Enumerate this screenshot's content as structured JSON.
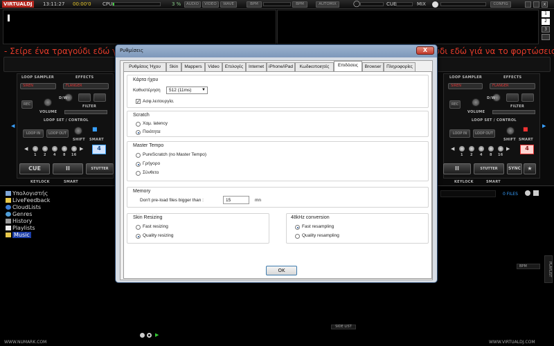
{
  "topbar": {
    "logo": "VIRTUALDJ",
    "clock": "13:11:27",
    "timer": "00:00'0",
    "cpu_label": "CPU",
    "cpu_value": "3 %",
    "buttons": [
      "AUDIO",
      "VIDEO",
      "WAVE",
      "BPM",
      "BPM",
      "AUTOMIX",
      "CUE",
      "MIX",
      "CONFIG"
    ]
  },
  "marquee": {
    "left": "- Σείρε ένα τραγούδι εδώ γι",
    "right": "ύδι εδώ γιά να το φορτώσεις"
  },
  "deck_left": {
    "loop_sampler": "LOOP SAMPLER",
    "effects": "EFFECTS",
    "sampler": "SIREN",
    "effect": "FLANGER",
    "rec": "REC",
    "volume": "VOLUME",
    "filter": "FILTER",
    "dw": "D/W",
    "loop_set": "LOOP SET / CONTROL",
    "loop_in": "LOOP IN",
    "loop_out": "LOOP OUT",
    "shift": "SHIFT",
    "smart": "SMART",
    "loop_value": "4",
    "beats": [
      "1",
      "2",
      "4",
      "8",
      "16"
    ],
    "cue": "CUE",
    "play": "II",
    "stutter": "STUTTER",
    "keylock": "KEYLOCK",
    "smart2": "SMART"
  },
  "deck_right": {
    "loop_sampler": "LOOP SAMPLER",
    "effects": "EFFECTS",
    "sampler": "SIREN",
    "effect": "FLANGER",
    "rec": "REC",
    "volume": "VOLUME",
    "filter": "FILTER",
    "dw": "D/W",
    "loop_set": "LOOP SET / CONTROL",
    "loop_in": "LOOP IN",
    "loop_out": "LOOP OUT",
    "shift": "SHIFT",
    "smart": "SMART",
    "loop_value": "4",
    "beats": [
      "1",
      "2",
      "4",
      "8",
      "16"
    ],
    "play": "II",
    "stutter": "STUTTER",
    "sync": "SYNC",
    "keylock": "KEYLOCK",
    "smart2": "SMART"
  },
  "browser": {
    "tree": [
      {
        "label": "Υπολογιστής",
        "icon": "computer-icon"
      },
      {
        "label": "LiveFeedback",
        "icon": "folder-icon"
      },
      {
        "label": "CloudLists",
        "icon": "cloud-icon"
      },
      {
        "label": "Genres",
        "icon": "genres-icon"
      },
      {
        "label": "History",
        "icon": "history-icon"
      },
      {
        "label": "Playlists",
        "icon": "playlist-icon"
      },
      {
        "label": "Music",
        "icon": "folder-icon"
      }
    ],
    "files_count": "0 FILES",
    "bpm_col": "BPM",
    "playlist_tab": "PLAYLIST",
    "side_list": "SIDE LIST"
  },
  "footer": {
    "left": "WWW.NUMARK.COM",
    "right": "WWW.VIRTUALDJ.COM"
  },
  "dialog": {
    "title": "Ρυθμίσεις",
    "close": "X",
    "tabs": [
      "Ρυθμίσεις Ήχου",
      "Skin",
      "Mappers",
      "Video",
      "Επιλογές",
      "Internet",
      "iPhone/iPad",
      "Κωδικοποιητές",
      "Επιδόσεις",
      "Browser",
      "Πληροφορίες"
    ],
    "active_tab": "Επιδόσεις",
    "soundcard": {
      "title": "Κάρτα ήχου",
      "latency_label": "Καθυστέρηση",
      "latency_value": "512 (11ms)",
      "safe_label": "Ασφ.λειτουργία.",
      "safe_checked": true
    },
    "scratch": {
      "title": "Scratch",
      "options": [
        "Χαμ. latency",
        "Ποιότητα"
      ],
      "selected": 1
    },
    "master_tempo": {
      "title": "Master Tempo",
      "options": [
        "PureScratch (no Master Tempo)",
        "Γρήγορο",
        "Σύνθετο"
      ],
      "selected": 1
    },
    "memory": {
      "title": "Memory",
      "preload_label": "Don't pre-load files bigger than :",
      "preload_value": "15",
      "unit": "mn"
    },
    "skin_resizing": {
      "title": "Skin Resizing",
      "options": [
        "Fast resizing",
        "Quality resizing"
      ],
      "selected": 1
    },
    "conversion": {
      "title": "48kHz conversion",
      "options": [
        "Fast resampling",
        "Quality resampling"
      ],
      "selected": 0
    },
    "ok": "OK"
  }
}
